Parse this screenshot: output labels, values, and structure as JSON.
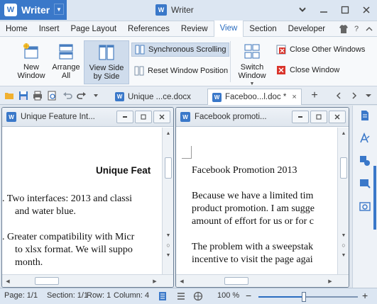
{
  "app": {
    "name": "Writer",
    "logo_letter": "W"
  },
  "window": {
    "title": "Writer"
  },
  "menu": [
    "Home",
    "Insert",
    "Page Layout",
    "References",
    "Review",
    "View",
    "Section",
    "Developer"
  ],
  "menu_active": "View",
  "ribbon": {
    "new_window": "New Window",
    "arrange_all": "Arrange All",
    "view_side_by_side": "View Side by Side",
    "synchronous_scrolling": "Synchronous Scrolling",
    "reset_window_position": "Reset Window Position",
    "switch_window": "Switch Window",
    "close_other_windows": "Close Other Windows",
    "close_window": "Close Window"
  },
  "tabs": [
    {
      "label": "Unique ...ce.docx"
    },
    {
      "label": "Faceboo...l.doc *"
    }
  ],
  "left_pane": {
    "title": "Unique Feature Int...",
    "heading": "Unique Feat",
    "lines": [
      ". Two interfaces: 2013 and classi",
      "and water blue.",
      ". Greater compatibility with Micr",
      "to xlsx format. We will suppo",
      "month."
    ]
  },
  "right_pane": {
    "title": "Facebook promoti...",
    "heading": "Facebook Promotion 2013",
    "para1": [
      "Because we have a limited tim",
      "product promotion. I am sugge",
      "amount of effort for us or for c"
    ],
    "para2": [
      "The problem with a sweepstak",
      "incentive to visit the page agai"
    ]
  },
  "status": {
    "page": "Page: 1/1",
    "section": "Section: 1/1",
    "row": "Row: 1",
    "column": "Column: 4",
    "zoom": "100 %",
    "zoom_value": 0.46
  },
  "colors": {
    "accent": "#3a78c9",
    "close_red": "#d9342b"
  }
}
